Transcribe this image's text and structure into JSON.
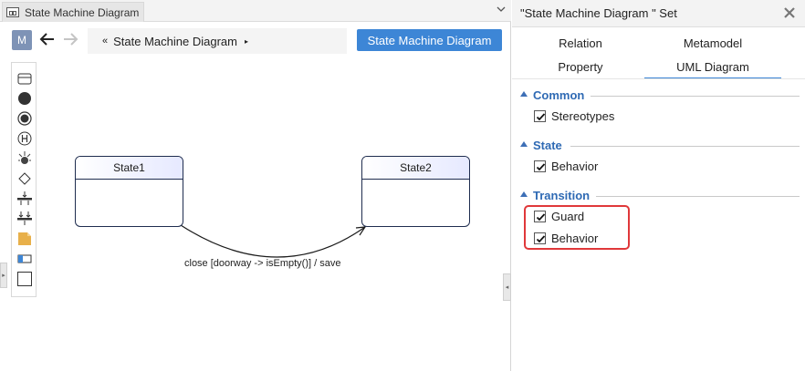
{
  "document_tab": {
    "title": "State Machine Diagram",
    "icon": "diagram-icon",
    "dropdown_icon": "chevron-down-icon"
  },
  "toolbar": {
    "model_badge": "M",
    "back_icon": "arrow-left-icon",
    "forward_icon": "arrow-right-icon",
    "breadcrumb_prefix": "«",
    "breadcrumb_label": "State Machine Diagram",
    "breadcrumb_suffix": "▸",
    "diagram_type_button": "State Machine Diagram"
  },
  "palette": {
    "items": [
      {
        "name": "state-tool",
        "icon": "rectangle-icon"
      },
      {
        "name": "initial-state-tool",
        "icon": "filled-circle-icon"
      },
      {
        "name": "final-state-tool",
        "icon": "bullseye-icon"
      },
      {
        "name": "history-tool",
        "icon": "history-h-icon"
      },
      {
        "name": "deep-history-tool",
        "icon": "deep-history-icon"
      },
      {
        "name": "choice-tool",
        "icon": "diamond-icon"
      },
      {
        "name": "fork-tool",
        "icon": "fork-bar-icon"
      },
      {
        "name": "join-tool",
        "icon": "join-bar-icon"
      },
      {
        "name": "note-tool",
        "icon": "note-icon"
      },
      {
        "name": "partition-tool",
        "icon": "partition-icon"
      },
      {
        "name": "frame-tool",
        "icon": "frame-icon"
      }
    ]
  },
  "diagram": {
    "states": [
      {
        "name": "State1"
      },
      {
        "name": "State2"
      }
    ],
    "transition_label": "close [doorway -> isEmpty()] / save"
  },
  "properties_panel": {
    "title": "\"State Machine Diagram \" Set",
    "close_icon": "close-icon",
    "tabs": [
      {
        "label": "Relation",
        "active": false
      },
      {
        "label": "Metamodel",
        "active": false
      },
      {
        "label": "Property",
        "active": false
      },
      {
        "label": "UML Diagram",
        "active": true
      }
    ],
    "sections": [
      {
        "title": "Common",
        "options": [
          {
            "label": "Stereotypes",
            "checked": true
          }
        ]
      },
      {
        "title": "State",
        "options": [
          {
            "label": "Behavior",
            "checked": true
          }
        ]
      },
      {
        "title": "Transition",
        "options": [
          {
            "label": "Guard",
            "checked": true
          },
          {
            "label": "Behavior",
            "checked": true
          }
        ]
      }
    ]
  },
  "colors": {
    "accent": "#3d86d6",
    "section_title": "#2f6ab4",
    "highlight": "#e0383a",
    "state_border": "#1f2d4f"
  }
}
